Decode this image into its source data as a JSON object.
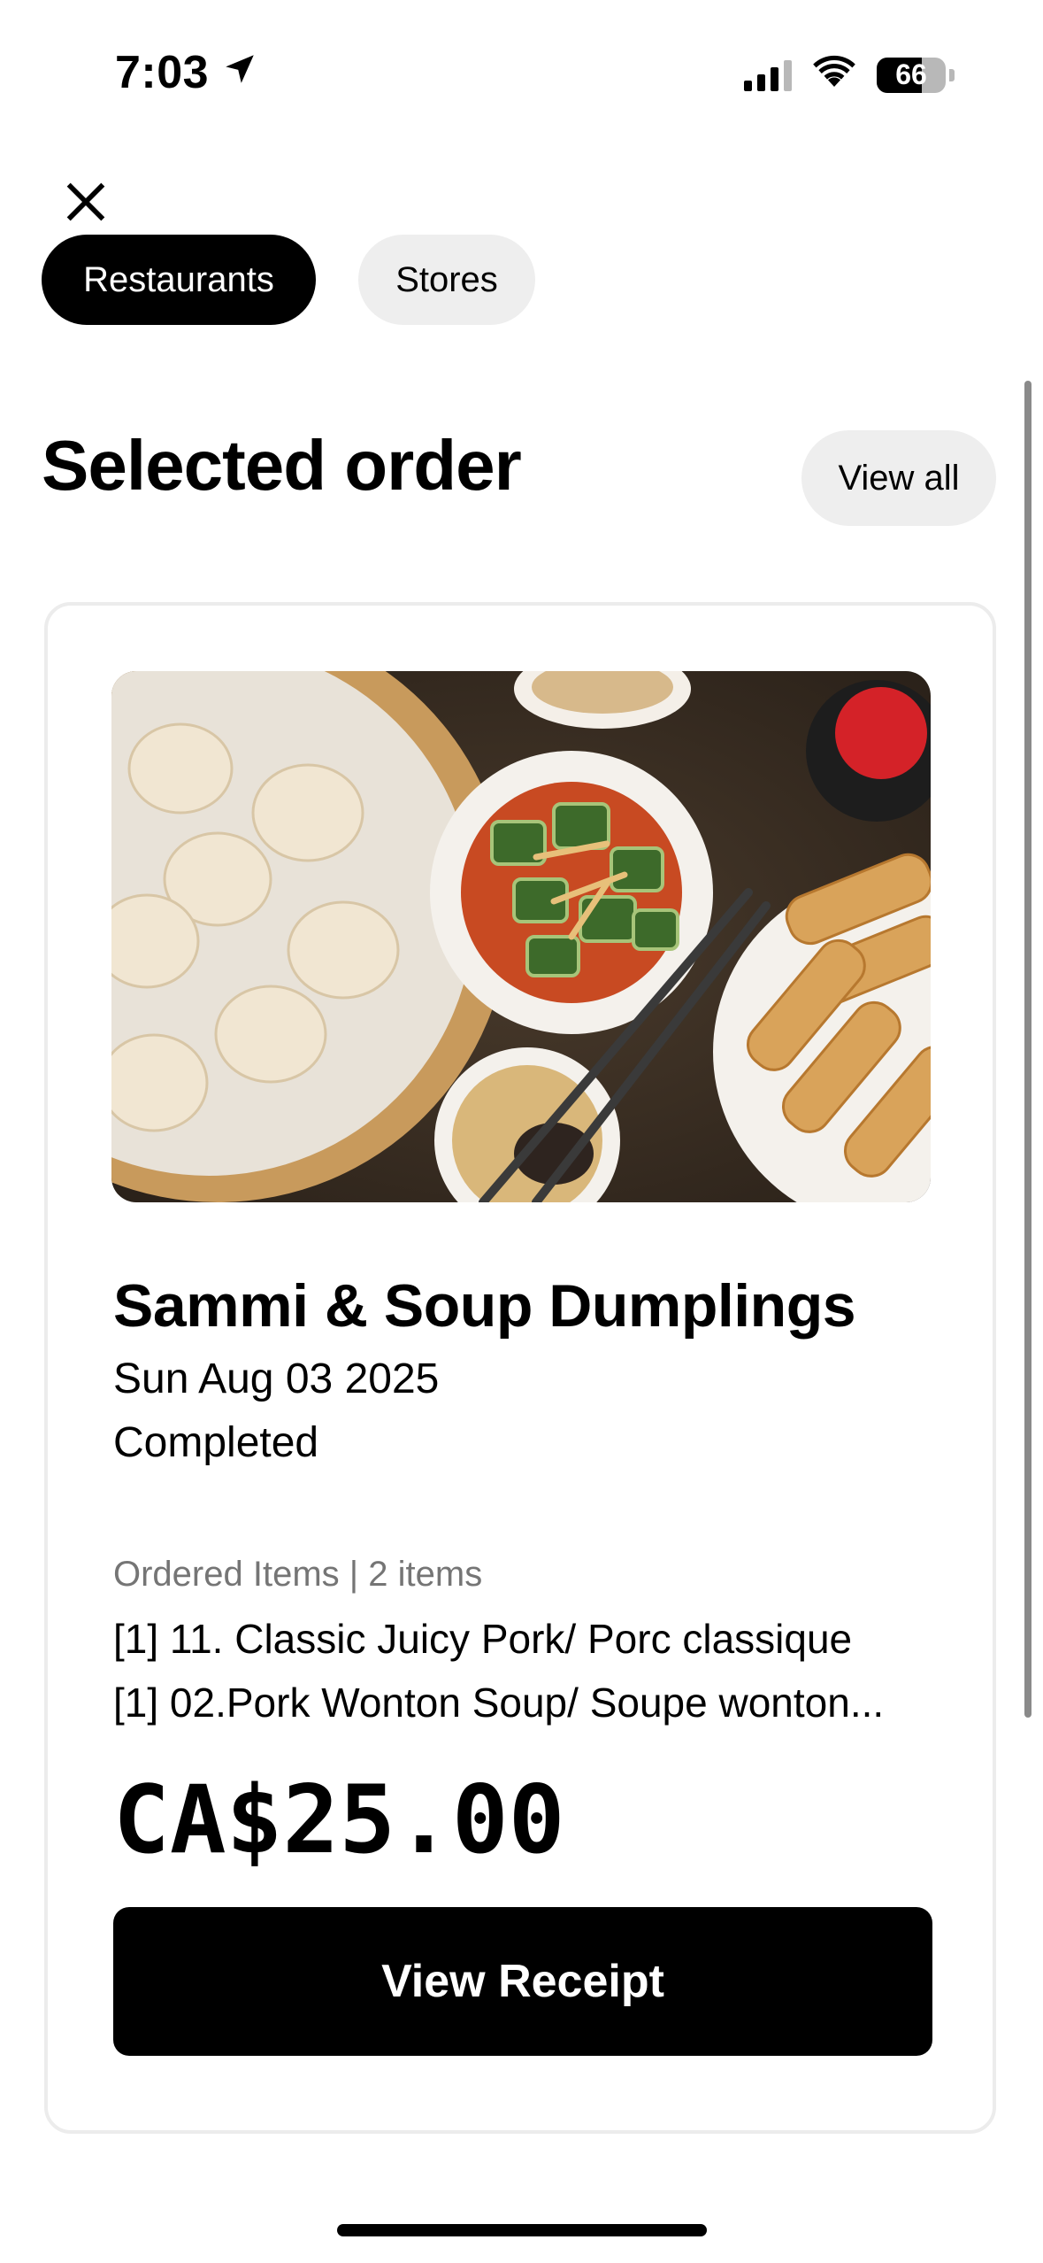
{
  "status_bar": {
    "time": "7:03",
    "battery": "66",
    "battery_level_percent": 66,
    "icons": [
      "location-arrow-icon",
      "cellular-signal-icon",
      "wifi-icon",
      "battery-icon"
    ]
  },
  "header": {
    "close_icon": "close-icon"
  },
  "filter_chips": [
    {
      "label": "Restaurants",
      "selected": true
    },
    {
      "label": "Stores",
      "selected": false
    }
  ],
  "section": {
    "title": "Selected order",
    "view_all_label": "View all"
  },
  "order": {
    "restaurant_name": "Sammi & Soup Dumplings",
    "date": "Sun Aug 03 2025",
    "status": "Completed",
    "items_header": "Ordered Items | 2 items",
    "items": [
      "[1] 11. Classic Juicy Pork/ Porc classique",
      "[1] 02.Pork Wonton Soup/ Soupe wonton..."
    ],
    "total": "CA$25.00",
    "view_receipt_label": "View Receipt"
  },
  "colors": {
    "primary": "#000000",
    "chip_inactive": "#eeeeee",
    "secondary_text": "#757575",
    "card_border": "#ececec"
  }
}
